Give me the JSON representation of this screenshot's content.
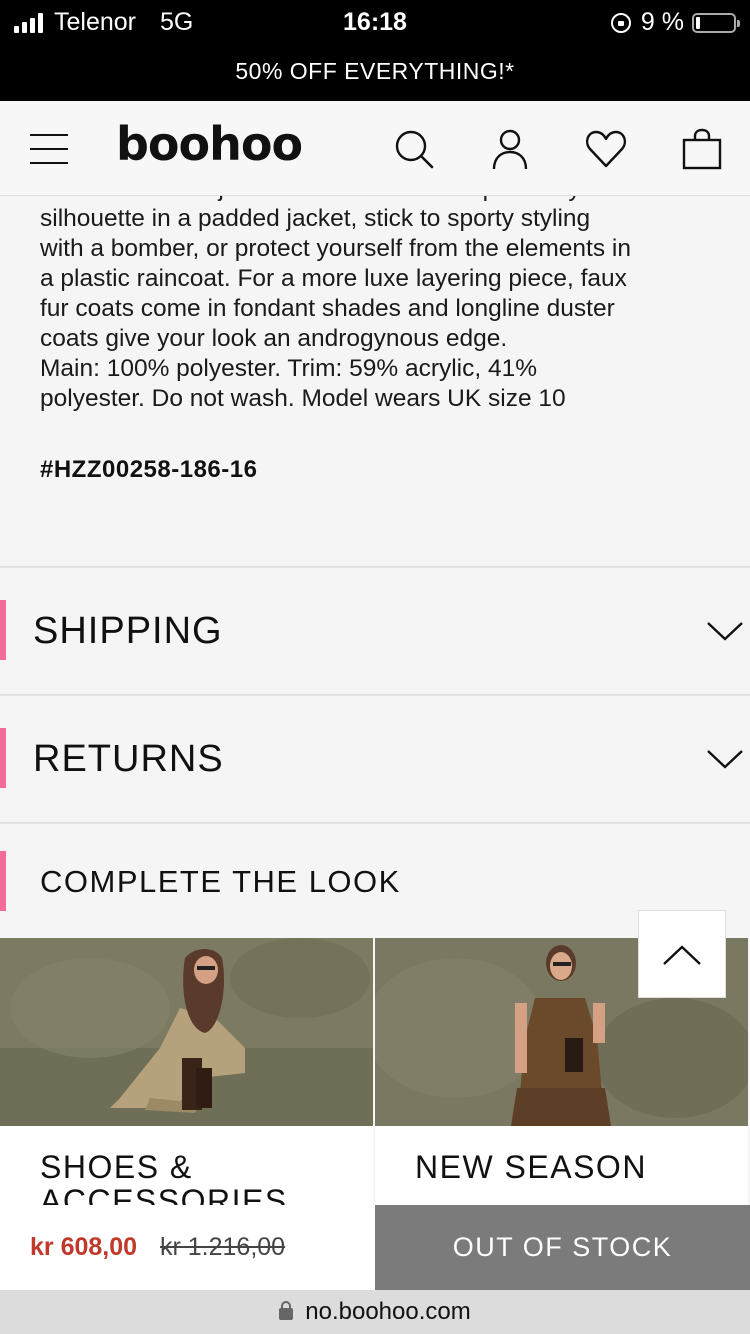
{
  "status_bar": {
    "carrier": "Telenor",
    "network": "5G",
    "time": "16:18",
    "battery": "9 %"
  },
  "promo": {
    "text": "50% OFF EVERYTHING!*"
  },
  "header": {
    "logo": "boohoo",
    "icons": [
      "menu-icon",
      "search-icon",
      "account-icon",
      "heart-icon",
      "bag-icon"
    ]
  },
  "description": {
    "partial_top": "latest coats and jackets from boohoo. Supersize your",
    "lines": [
      "silhouette in a padded jacket, stick to sporty styling",
      "with a bomber, or protect yourself from the elements in",
      "a plastic raincoat. For a more luxe layering piece, faux",
      "fur coats come in fondant shades and longline duster",
      "coats give your look an androgynous edge.",
      "Main: 100% polyester. Trim: 59% acrylic, 41%",
      "polyester. Do not wash. Model wears UK size 10"
    ],
    "sku": "#HZZ00258-186-16"
  },
  "accordions": [
    {
      "label": "SHIPPING"
    },
    {
      "label": "RETURNS"
    }
  ],
  "complete_the_look": {
    "title": "COMPLETE THE LOOK",
    "tiles": [
      {
        "label_line1": "SHOES &",
        "label_line2": "ACCESSORIES"
      },
      {
        "label_line1": "NEW SEASON"
      }
    ]
  },
  "buy_bar": {
    "price": "kr 608,00",
    "was_price": "kr 1.216,00",
    "button": "OUT OF STOCK"
  },
  "url_bar": {
    "url": "no.boohoo.com"
  },
  "colors": {
    "accent_pink": "#f36b9a",
    "price_red": "#c0392b",
    "oos_grey": "#7b7b7b"
  }
}
